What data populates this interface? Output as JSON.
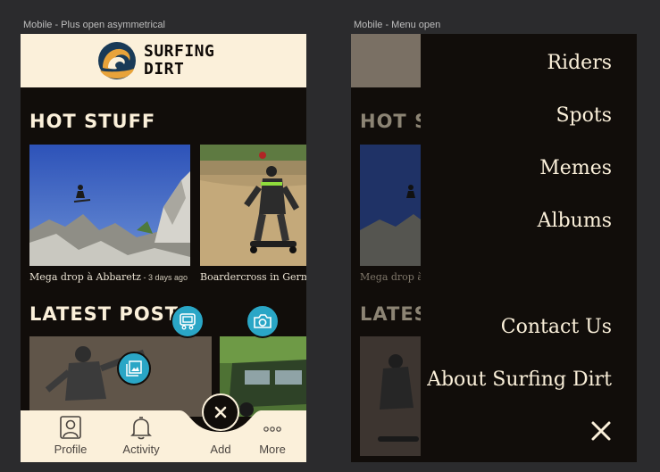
{
  "frames": {
    "left_label": "Mobile - Plus open asymmetrical",
    "right_label": "Mobile - Menu open"
  },
  "brand": {
    "name_line1": "SURFING",
    "name_line2": "DIRT"
  },
  "sections": {
    "hot_stuff": "HOT STUFF",
    "latest_posts": "LATEST POSTS",
    "hot_stuff_partial": "HOT S",
    "latest_partial": "LATES"
  },
  "hot_stuff_cards": [
    {
      "title": "Mega drop à Abbaretz",
      "meta": " - 3 days ago"
    },
    {
      "title": "Boardercross in Germany",
      "meta": ""
    }
  ],
  "dim_caption": "Mega drop à",
  "tabbar": {
    "profile": "Profile",
    "activity": "Activity",
    "add": "Add",
    "more": "More"
  },
  "menu": {
    "items": [
      "Riders",
      "Spots",
      "Memes",
      "Albums"
    ],
    "secondary": [
      "Contact Us",
      "About Surfing Dirt"
    ]
  },
  "icons": {
    "logo": "wave-logo",
    "fab_upload_video": "video-upload-icon",
    "fab_camera": "camera-icon",
    "fab_gallery": "gallery-icon",
    "close": "close-icon",
    "profile": "profile-icon",
    "activity": "bell-icon",
    "more": "more-dots-icon",
    "menu_close": "close-icon"
  },
  "colors": {
    "background": "#2b2b2d",
    "surface_dark": "#110d0a",
    "cream": "#fbf0da",
    "accent_blue": "#2aa6c6",
    "logo_orange": "#e8a33a",
    "logo_navy": "#193a57"
  }
}
